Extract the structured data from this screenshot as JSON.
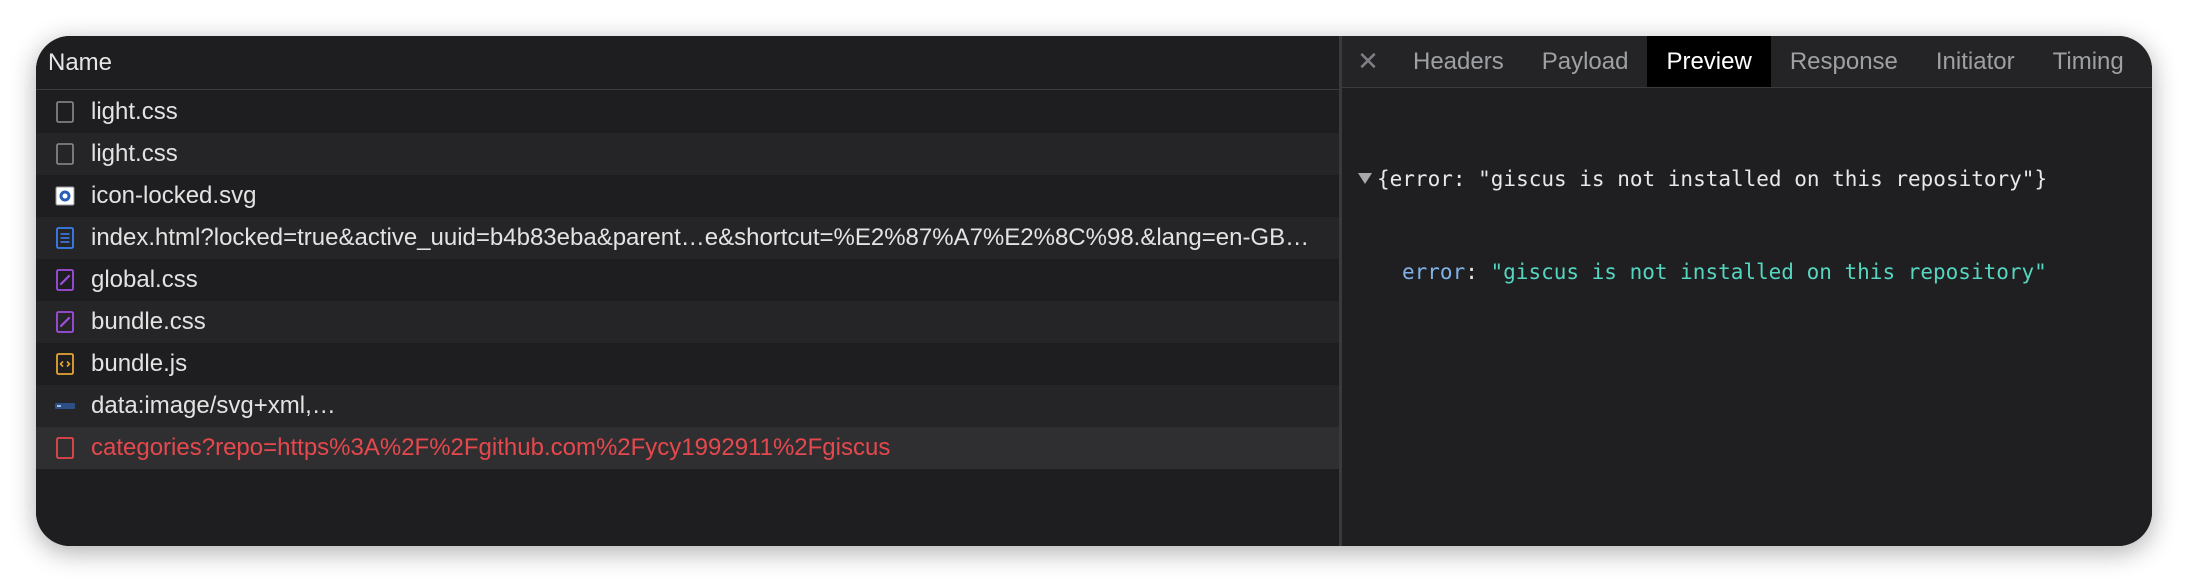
{
  "network": {
    "column_header": "Name",
    "requests": [
      {
        "name": "light.css",
        "icon": "blank-file-icon",
        "status": "normal"
      },
      {
        "name": "light.css",
        "icon": "blank-file-icon",
        "status": "normal"
      },
      {
        "name": "icon-locked.svg",
        "icon": "image-file-icon",
        "status": "normal"
      },
      {
        "name": "index.html?locked=true&active_uuid=b4b83eba&parent…e&shortcut=%E2%87%A7%E2%8C%98.&lang=en-GB…",
        "icon": "document-file-icon",
        "status": "normal"
      },
      {
        "name": "global.css",
        "icon": "stylesheet-file-icon",
        "status": "normal"
      },
      {
        "name": "bundle.css",
        "icon": "stylesheet-file-icon",
        "status": "normal"
      },
      {
        "name": "bundle.js",
        "icon": "script-file-icon",
        "status": "normal"
      },
      {
        "name": "data:image/svg+xml,…",
        "icon": "inline-image-icon",
        "status": "normal"
      },
      {
        "name": "categories?repo=https%3A%2F%2Fgithub.com%2Fycy1992911%2Fgiscus",
        "icon": "failed-request-icon",
        "status": "error"
      }
    ]
  },
  "details": {
    "close_icon": "close-icon",
    "close_glyph": "✕",
    "tabs": [
      "Headers",
      "Payload",
      "Preview",
      "Response",
      "Initiator",
      "Timing"
    ],
    "active_tab": "Preview",
    "preview": {
      "summary": "{error: \"giscus is not installed on this repository\"}",
      "key": "error",
      "separator": ": ",
      "value": "\"giscus is not installed on this repository\""
    }
  },
  "colors": {
    "error": "#e5484d",
    "css_icon": "#a04ee0",
    "js_icon": "#e3a533",
    "doc_icon": "#3b7ff0",
    "key": "#7fb2e6",
    "string": "#55d6c0"
  }
}
